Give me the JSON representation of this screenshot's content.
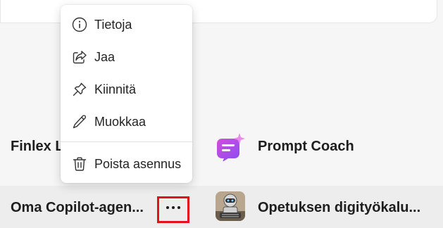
{
  "context_menu": {
    "items": [
      {
        "label": "Tietoja",
        "icon": "info-icon"
      },
      {
        "label": "Jaa",
        "icon": "share-icon"
      },
      {
        "label": "Kiinnitä",
        "icon": "pin-icon"
      },
      {
        "label": "Muokkaa",
        "icon": "edit-pencil-icon"
      },
      {
        "label": "Poista asennus",
        "icon": "trash-icon"
      }
    ]
  },
  "apps": {
    "finlex": {
      "label": "Finlex L"
    },
    "prompt_coach": {
      "label": "Prompt Coach",
      "icon": "prompt-coach-icon"
    },
    "oma_copilot": {
      "label": "Oma Copilot-agen..."
    },
    "opetuksen": {
      "label": "Opetuksen digityökalu...",
      "icon": "robot-avatar-icon"
    }
  },
  "colors": {
    "highlight_border": "#e0121c",
    "prompt_coach_gradient_start": "#c84ee0",
    "prompt_coach_gradient_end": "#8a4cf0"
  }
}
